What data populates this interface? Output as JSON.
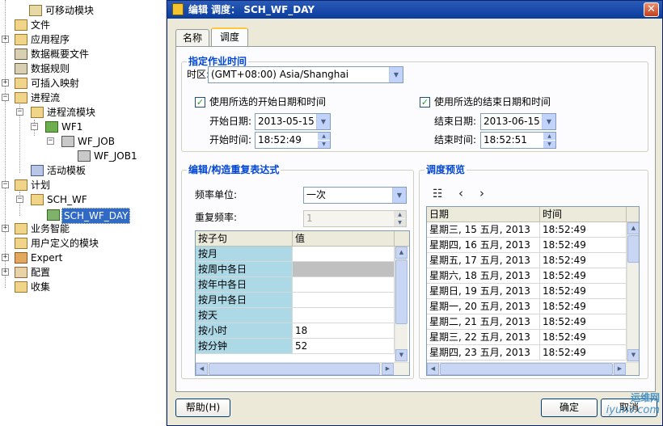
{
  "tree": {
    "items": [
      {
        "label": "可移动模块",
        "icon": "module-icon"
      },
      {
        "label": "文件",
        "icon": "file-icon"
      },
      {
        "label": "应用程序",
        "icon": "application-icon"
      },
      {
        "label": "数据概要文件",
        "icon": "data-profile-icon"
      },
      {
        "label": "数据规则",
        "icon": "data-rule-icon"
      },
      {
        "label": "可插入映射",
        "icon": "mapping-icon"
      },
      {
        "label": "进程流",
        "icon": "process-flow-icon"
      },
      {
        "label": "进程流模块",
        "icon": "process-module-icon"
      },
      {
        "label": "WF1",
        "icon": "package-icon"
      },
      {
        "label": "WF_JOB",
        "icon": "workflow-icon"
      },
      {
        "label": "WF_JOB1",
        "icon": "workflow-icon"
      },
      {
        "label": "活动模板",
        "icon": "template-icon"
      },
      {
        "label": "计划",
        "icon": "schedule-folder-icon"
      },
      {
        "label": "SCH_WF",
        "icon": "schedule-module-icon"
      },
      {
        "label": "SCH_WF_DAY",
        "icon": "schedule-icon"
      },
      {
        "label": "业务智能",
        "icon": "bi-icon"
      },
      {
        "label": "用户定义的模块",
        "icon": "user-module-icon"
      },
      {
        "label": "Expert",
        "icon": "expert-icon"
      },
      {
        "label": "配置",
        "icon": "config-icon"
      },
      {
        "label": "收集",
        "icon": "collection-icon"
      }
    ]
  },
  "dialog": {
    "title": "编辑  调度：  SCH_WF_DAY",
    "close": "✕",
    "tabs": [
      "名称",
      "调度"
    ],
    "schedule_group": {
      "title": "指定作业时间",
      "timezone_label": "时区:",
      "timezone_value": "(GMT+08:00)  Asia/Shanghai",
      "use_start_label": "使用所选的开始日期和时间",
      "use_end_label": "使用所选的结束日期和时间",
      "start_date_label": "开始日期:",
      "start_date": "2013-05-15",
      "start_time_label": "开始时间:",
      "start_time": "18:52:49",
      "end_date_label": "结束日期:",
      "end_date": "2013-06-15",
      "end_time_label": "结束时间:",
      "end_time": "18:52:51"
    },
    "repeat_group": {
      "title": "编辑/构造重复表达式",
      "freq_unit_label": "频率单位:",
      "freq_unit_value": "一次",
      "repeat_freq_label": "重复频率:",
      "repeat_freq_value": "1",
      "columns": [
        "按子句",
        "值"
      ],
      "rows": [
        {
          "clause": "按月",
          "value": ""
        },
        {
          "clause": "按周中各日",
          "value": ""
        },
        {
          "clause": "按年中各日",
          "value": ""
        },
        {
          "clause": "按月中各日",
          "value": ""
        },
        {
          "clause": "按天",
          "value": ""
        },
        {
          "clause": "按小时",
          "value": "18"
        },
        {
          "clause": "按分钟",
          "value": "52"
        }
      ]
    },
    "preview_group": {
      "title": "调度预览",
      "columns": [
        "日期",
        "时间"
      ],
      "rows": [
        {
          "date": "星期三, 15 五月, 2013",
          "time": "18:52:49"
        },
        {
          "date": "星期四, 16 五月, 2013",
          "time": "18:52:49"
        },
        {
          "date": "星期五, 17 五月, 2013",
          "time": "18:52:49"
        },
        {
          "date": "星期六, 18 五月, 2013",
          "time": "18:52:49"
        },
        {
          "date": "星期日, 19 五月, 2013",
          "time": "18:52:49"
        },
        {
          "date": "星期一, 20 五月, 2013",
          "time": "18:52:49"
        },
        {
          "date": "星期二, 21 五月, 2013",
          "time": "18:52:49"
        },
        {
          "date": "星期三, 22 五月, 2013",
          "time": "18:52:49"
        },
        {
          "date": "星期四, 23 五月, 2013",
          "time": "18:52:49"
        }
      ]
    },
    "buttons": {
      "help": "帮助(H)",
      "ok": "确定",
      "cancel": "取消"
    }
  },
  "watermark": {
    "line1": "运维网",
    "line2": "iyunv.com"
  }
}
